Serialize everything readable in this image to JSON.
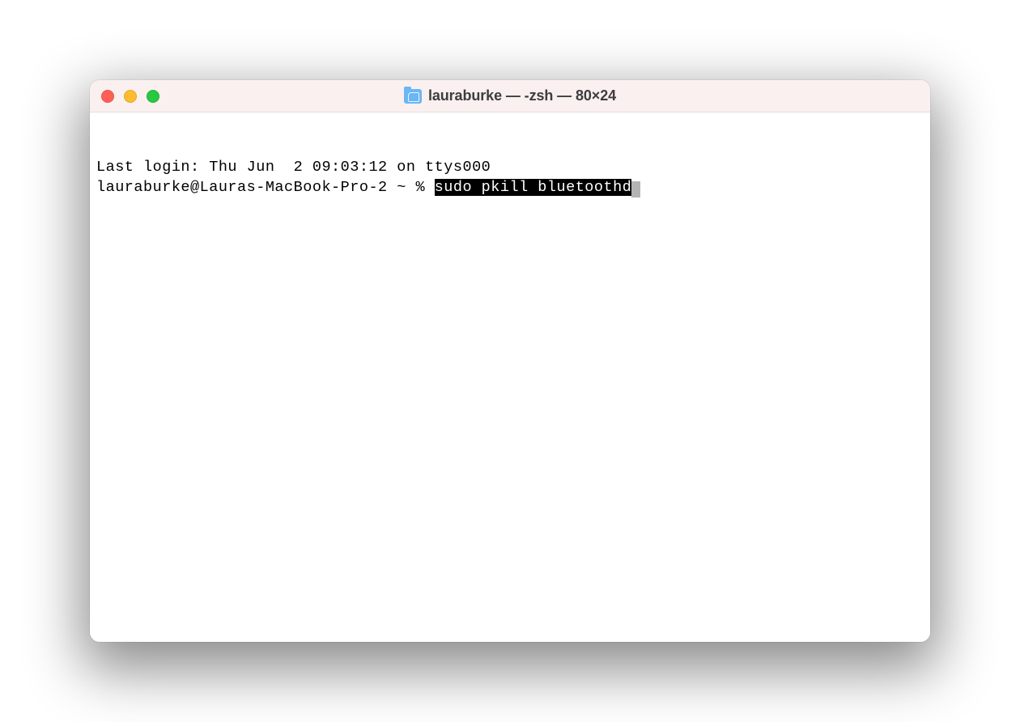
{
  "titlebar": {
    "title": "lauraburke — -zsh — 80×24",
    "folder_icon": "home-folder-icon"
  },
  "terminal": {
    "last_login_line": "Last login: Thu Jun  2 09:03:12 on ttys000",
    "prompt": "lauraburke@Lauras-MacBook-Pro-2 ~ % ",
    "command_selected": "sudo pkill bluetoothd"
  }
}
